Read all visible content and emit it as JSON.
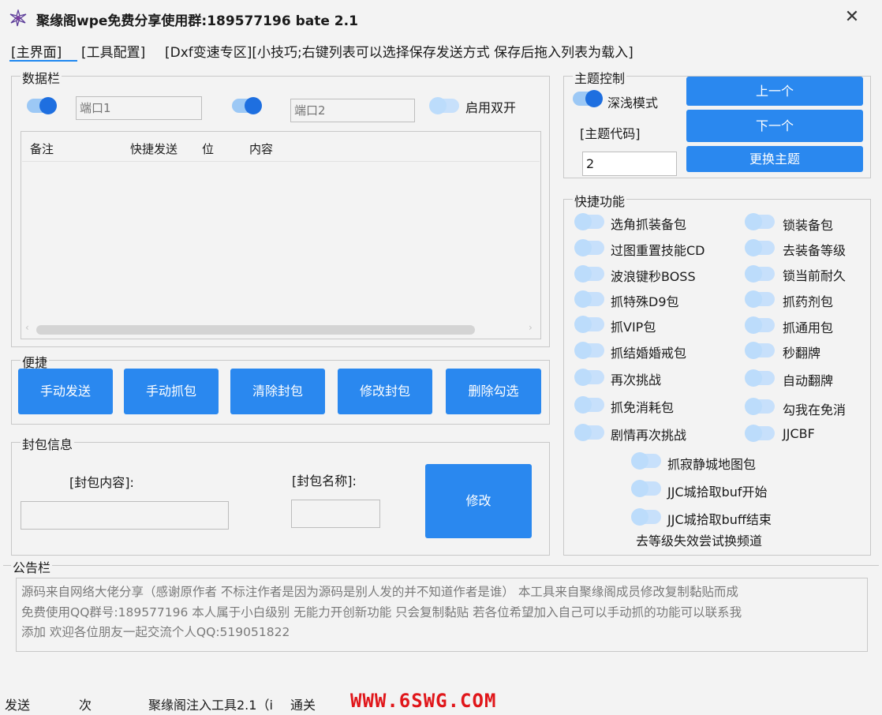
{
  "window": {
    "title": "聚缘阁wpe免费分享使用群:189577196 bate 2.1",
    "close_label": "✕"
  },
  "tabs": [
    {
      "label": "[主界面]"
    },
    {
      "label": "[工具配置]"
    },
    {
      "label": "[Dxf变速专区][小技巧;右键列表可以选择保存发送方式 保存后拖入列表为载入]"
    }
  ],
  "data_panel": {
    "title": "数据栏",
    "port1_placeholder": "端口1",
    "port2_placeholder": "端口2",
    "dual_open_label": "启用双开",
    "columns": [
      "备注",
      "快捷发送",
      "位",
      "内容"
    ]
  },
  "shortcut_panel": {
    "title": "便捷",
    "buttons": [
      "手动发送",
      "手动抓包",
      "清除封包",
      "修改封包",
      "删除勾选"
    ]
  },
  "packet_info": {
    "title": "封包信息",
    "content_label": "[封包内容]:",
    "name_label": "[封包名称]:",
    "modify_label": "修改"
  },
  "theme_panel": {
    "title": "主题控制",
    "dark_mode_label": "深浅模式",
    "code_label": "[主题代码]",
    "code_value": "2",
    "prev_label": "上一个",
    "next_label": "下一个",
    "change_label": "更换主题"
  },
  "quick_panel": {
    "title": "快捷功能",
    "left": [
      "选角抓装备包",
      "过图重置技能CD",
      "波浪键秒BOSS",
      "抓特殊D9包",
      "抓VIP包",
      "抓结婚婚戒包",
      "再次挑战",
      "抓免消耗包",
      "剧情再次挑战"
    ],
    "right": [
      "锁装备包",
      "去装备等级",
      "锁当前耐久",
      "抓药剂包",
      "抓通用包",
      "秒翻牌",
      "自动翻牌",
      "勾我在免消",
      "JJCBF"
    ],
    "center": [
      "抓寂静城地图包",
      "JJC城拾取buf开始",
      "JJC城拾取buff结束"
    ],
    "footer": "去等级失效尝试换频道"
  },
  "notice": {
    "title": "公告栏",
    "lines": [
      "源码来自网络大佬分享（感谢原作者 不标注作者是因为源码是别人发的并不知道作者是谁） 本工具来自聚缘阁成员修改复制黏贴而成",
      "免费使用QQ群号:189577196 本人属于小白级别 无能力开创新功能 只会复制黏贴 若各位希望加入自己可以手动抓的功能可以联系我",
      "添加 欢迎各位朋友一起交流个人QQ:519051822"
    ]
  },
  "status_bar": {
    "send_label": "发送",
    "count_label": "次",
    "tool_label": "聚缘阁注入工具2.1（i",
    "pass_label": "通关",
    "watermark": "WWW.6SWG.COM"
  },
  "colors": {
    "accent": "#2a88ef",
    "toggle_on": "#1e6fe0",
    "toggle_off": "#bcdcfb",
    "watermark": "#e0161a"
  },
  "icons": {
    "app": "flower-logo-icon",
    "close": "close-icon"
  }
}
